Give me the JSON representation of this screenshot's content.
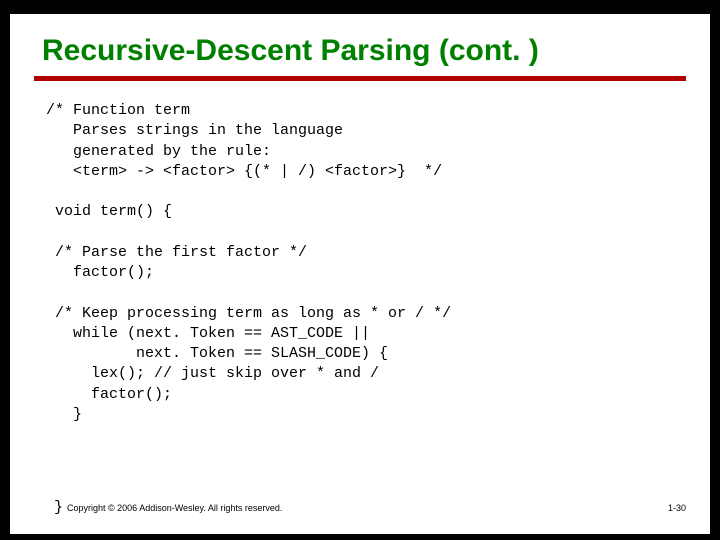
{
  "title": "Recursive-Descent Parsing (cont. )",
  "code": {
    "l1": "/* Function term",
    "l2": "   Parses strings in the language",
    "l3": "   generated by the rule:",
    "l4": "   <term> -> <factor> {(* | /) <factor>}  */",
    "l5": "",
    "l6": " void term() {",
    "l7": "",
    "l8": " /* Parse the first factor */",
    "l9": "   factor();",
    "l10": "",
    "l11": " /* Keep processing term as long as * or / */",
    "l12": "   while (next. Token == AST_CODE ||",
    "l13": "          next. Token == SLASH_CODE) {",
    "l14": "     lex(); // just skip over * and /",
    "l15": "     factor();",
    "l16": "   }"
  },
  "footer": {
    "closebrace": "}",
    "copyright": "Copyright © 2006 Addison-Wesley. All rights reserved.",
    "pagenum": "1-30"
  }
}
